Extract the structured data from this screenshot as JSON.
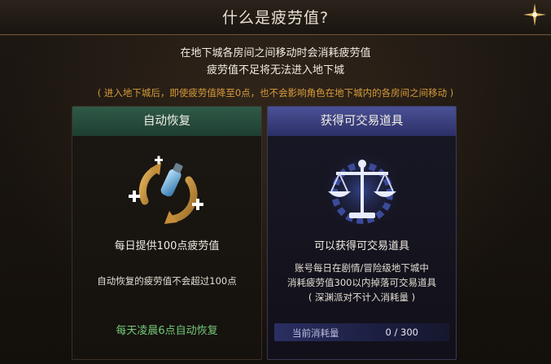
{
  "header": {
    "title": "什么是疲劳值?"
  },
  "intro": {
    "line1": "在地下城各房间之间移动时会消耗疲劳值",
    "line2": "疲劳值不足将无法进入地下城"
  },
  "note": "( 进入地下城后，即使疲劳值降至0点，也不会影响角色在地下城内的各房间之间移动 )",
  "cards": {
    "auto": {
      "title": "自动恢复",
      "daily": "每日提供100点疲劳值",
      "limit": "自动恢复的疲劳值不会超过100点",
      "reset": "每天凌晨6点自动恢复",
      "icon": "fatigue-potion-recovery-icon"
    },
    "trade": {
      "title": "获得可交易道具",
      "subtitle": "可以获得可交易道具",
      "desc_line1": "账号每日在剧情/冒险级地下城中",
      "desc_line2": "消耗疲劳值300以内掉落可交易道具",
      "desc_line3": "( 深渊派对不计入消耗量 )",
      "progress_label": "当前消耗量",
      "progress_value": "0 / 300",
      "icon": "scales-icon"
    }
  },
  "colors": {
    "note": "#d79b3a",
    "reset_text": "#74c97a",
    "auto_header": "#2f5a48",
    "trade_header": "#4a5196"
  }
}
